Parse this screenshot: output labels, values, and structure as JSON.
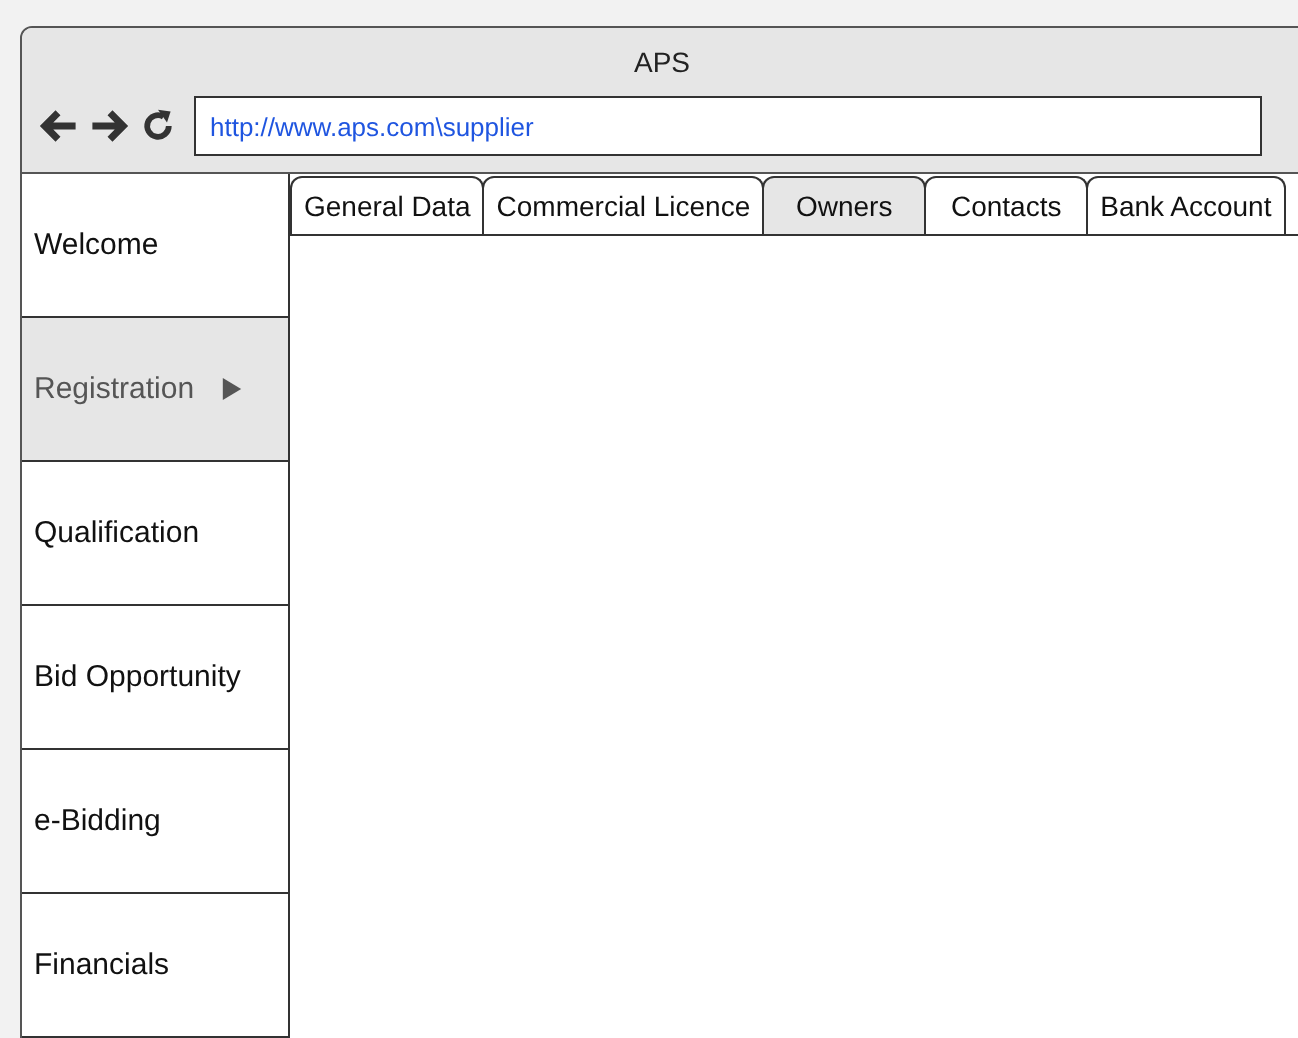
{
  "window": {
    "title": "APS"
  },
  "address_bar": {
    "value": "http://www.aps.com\\supplier"
  },
  "sidebar": {
    "items": [
      {
        "label": "Welcome",
        "selected": false,
        "has_submenu": false
      },
      {
        "label": "Registration",
        "selected": true,
        "has_submenu": true
      },
      {
        "label": "Qualification",
        "selected": false,
        "has_submenu": false
      },
      {
        "label": "Bid Opportunity",
        "selected": false,
        "has_submenu": false
      },
      {
        "label": "e-Bidding",
        "selected": false,
        "has_submenu": false
      },
      {
        "label": "Financials",
        "selected": false,
        "has_submenu": false
      }
    ]
  },
  "tabs": [
    {
      "label": "General Data",
      "selected": false
    },
    {
      "label": "Commercial Licence",
      "selected": false
    },
    {
      "label": "Owners",
      "selected": true
    },
    {
      "label": "Contacts",
      "selected": false
    },
    {
      "label": "Bank Account",
      "selected": false
    }
  ]
}
